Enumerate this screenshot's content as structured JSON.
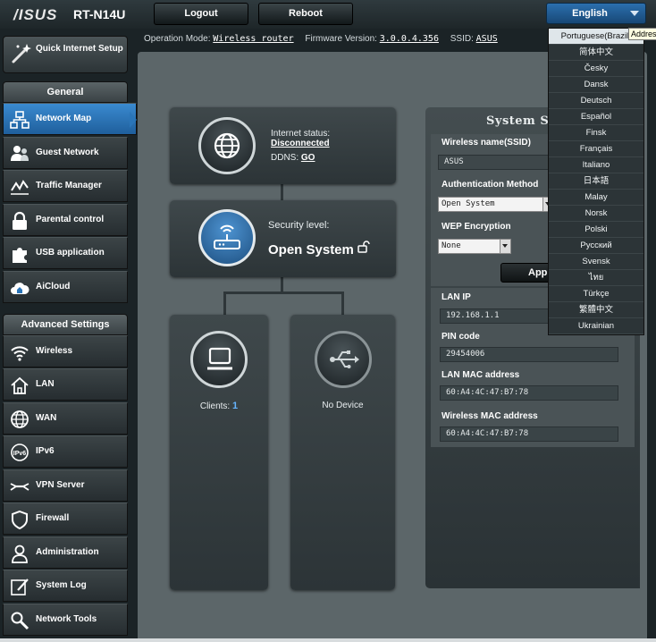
{
  "header": {
    "brand": "/ISUS",
    "model": "RT-N14U",
    "logout": "Logout",
    "reboot": "Reboot",
    "language": "English"
  },
  "status_line": {
    "op_mode_label": "Operation Mode:",
    "op_mode_value": "Wireless router",
    "firmware_label": "Firmware Version:",
    "firmware_value": "3.0.0.4.356",
    "ssid_label": "SSID:",
    "ssid_value": "ASUS"
  },
  "sidebar": {
    "quick_setup": "Quick Internet Setup",
    "general_header": "General",
    "general_items": [
      {
        "label": "Network Map",
        "icon": "network-map-icon"
      },
      {
        "label": "Guest Network",
        "icon": "guest-network-icon"
      },
      {
        "label": "Traffic Manager",
        "icon": "traffic-manager-icon"
      },
      {
        "label": "Parental control",
        "icon": "lock-icon"
      },
      {
        "label": "USB application",
        "icon": "puzzle-icon"
      },
      {
        "label": "AiCloud",
        "icon": "cloud-icon"
      }
    ],
    "advanced_header": "Advanced Settings",
    "advanced_items": [
      {
        "label": "Wireless",
        "icon": "wireless-icon"
      },
      {
        "label": "LAN",
        "icon": "home-icon"
      },
      {
        "label": "WAN",
        "icon": "globe-icon"
      },
      {
        "label": "IPv6",
        "icon": "ipv6-icon"
      },
      {
        "label": "VPN Server",
        "icon": "vpn-icon"
      },
      {
        "label": "Firewall",
        "icon": "shield-icon"
      },
      {
        "label": "Administration",
        "icon": "admin-user-icon"
      },
      {
        "label": "System Log",
        "icon": "log-icon"
      },
      {
        "label": "Network Tools",
        "icon": "tools-icon"
      }
    ]
  },
  "network_map": {
    "internet_status_label": "Internet status:",
    "internet_status_value": "Disconnected",
    "ddns_label": "DDNS:",
    "ddns_value": "GO",
    "security_label": "Security level:",
    "security_value": "Open System",
    "clients_label": "Clients:",
    "clients_count": "1",
    "usb_status": "No Device"
  },
  "system_status": {
    "title": "System St",
    "ssid_label": "Wireless name(SSID)",
    "ssid_value": "ASUS",
    "auth_label": "Authentication Method",
    "auth_value": "Open System",
    "wep_label": "WEP Encryption",
    "wep_value": "None",
    "apply": "Appl",
    "lan_ip_label": "LAN IP",
    "lan_ip_value": "192.168.1.1",
    "pin_label": "PIN code",
    "pin_value": "29454006",
    "lan_mac_label": "LAN MAC address",
    "lan_mac_value": "60:A4:4C:47:B7:78",
    "wl_mac_label": "Wireless MAC address",
    "wl_mac_value": "60:A4:4C:47:B7:78"
  },
  "language_menu": {
    "options": [
      "Portuguese(Brazil)",
      "简体中文",
      "Česky",
      "Dansk",
      "Deutsch",
      "Español",
      "Finsk",
      "Français",
      "Italiano",
      "日本語",
      "Malay",
      "Norsk",
      "Polski",
      "Русский",
      "Svensk",
      "ไทย",
      "Türkçe",
      "繁體中文",
      "Ukrainian"
    ],
    "tooltip": "Address"
  }
}
